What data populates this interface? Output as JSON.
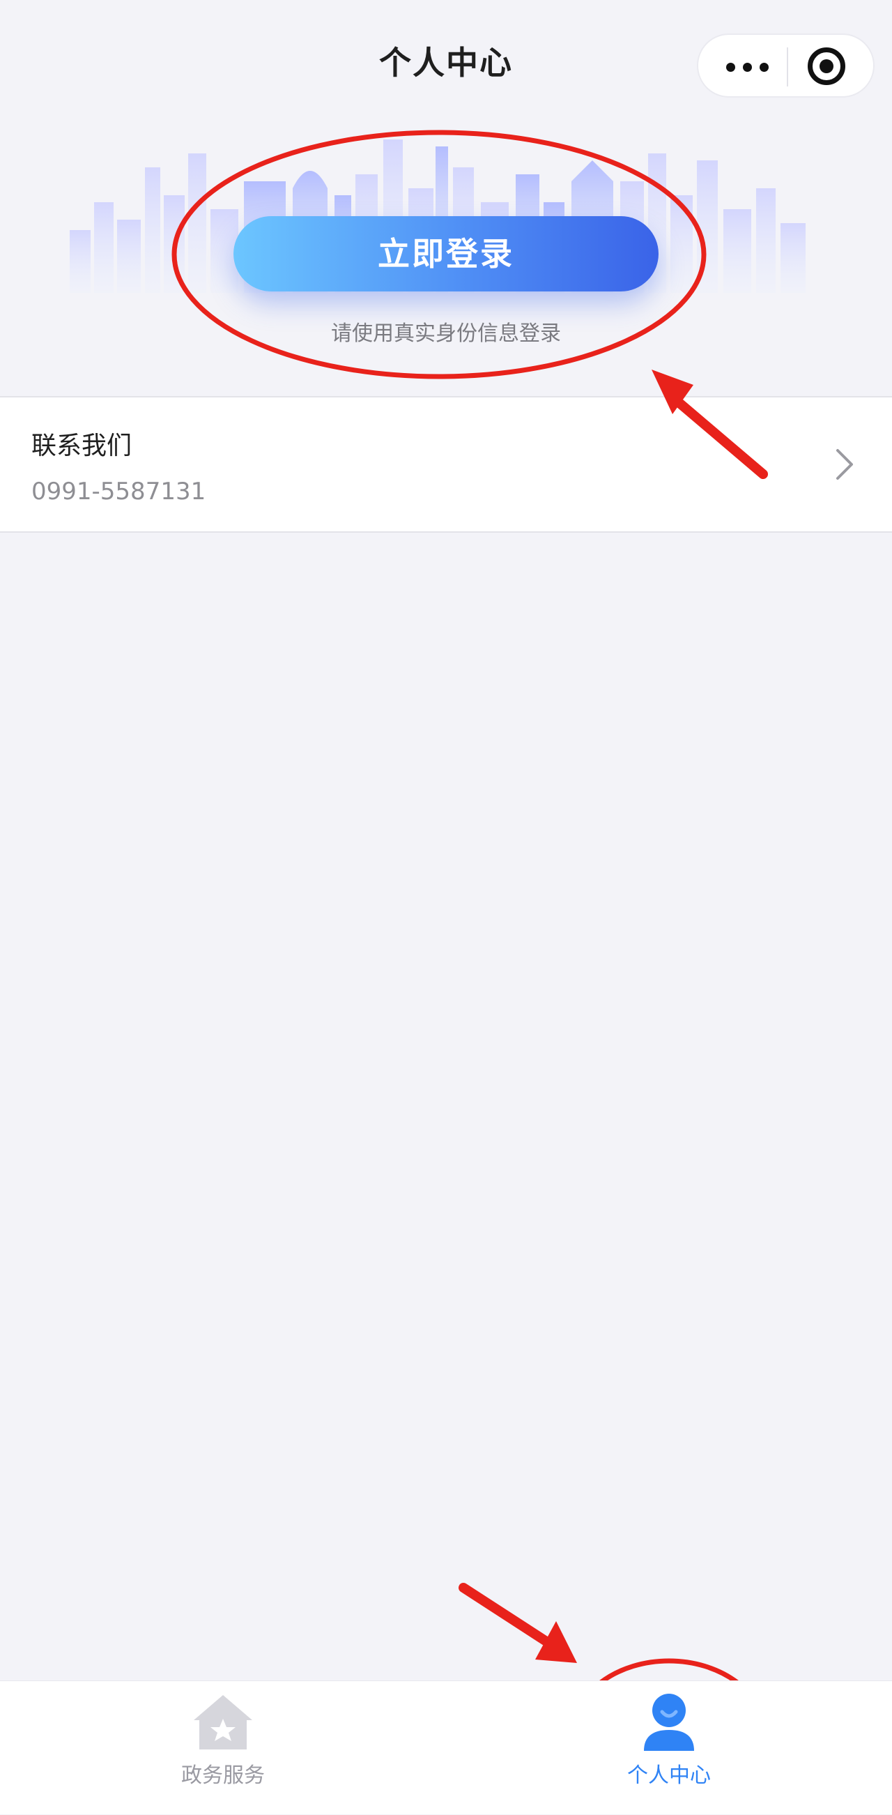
{
  "header": {
    "title": "个人中心",
    "more_icon": "more-dots-icon",
    "close_icon": "target-icon"
  },
  "hero": {
    "login_button": "立即登录",
    "hint": "请使用真实身份信息登录",
    "background_icon": "city-skyline-illustration"
  },
  "contact": {
    "title": "联系我们",
    "phone": "0991-5587131",
    "chevron_icon": "chevron-right-icon"
  },
  "tabbar": {
    "tabs": [
      {
        "label": "政务服务",
        "icon": "home-star-icon",
        "active": false
      },
      {
        "label": "个人中心",
        "icon": "user-icon",
        "active": true
      }
    ]
  },
  "colors": {
    "background": "#f3f3f8",
    "accent": "#2f83f5",
    "login_gradient_start": "#6cc6ff",
    "login_gradient_end": "#3a63e8",
    "annotation_red": "#e8221b"
  }
}
